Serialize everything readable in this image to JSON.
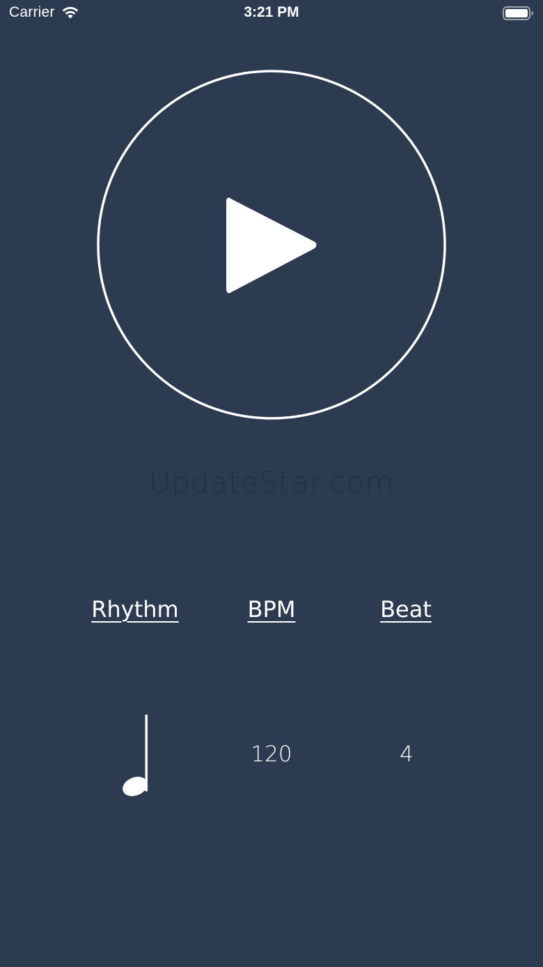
{
  "status_bar": {
    "carrier": "Carrier",
    "time": "3:21 PM",
    "wifi_icon": "wifi-icon",
    "battery_icon": "battery-icon"
  },
  "player": {
    "play_icon": "play-icon"
  },
  "watermark": {
    "text": "UpdateStar.com"
  },
  "settings": {
    "headers": {
      "rhythm": "Rhythm",
      "bpm": "BPM",
      "beat": "Beat"
    },
    "values": {
      "rhythm_icon": "quarter-note-icon",
      "bpm": "120",
      "beat": "4"
    }
  },
  "colors": {
    "background": "#2d3b51",
    "foreground": "#ffffff",
    "watermark": "#243044"
  }
}
